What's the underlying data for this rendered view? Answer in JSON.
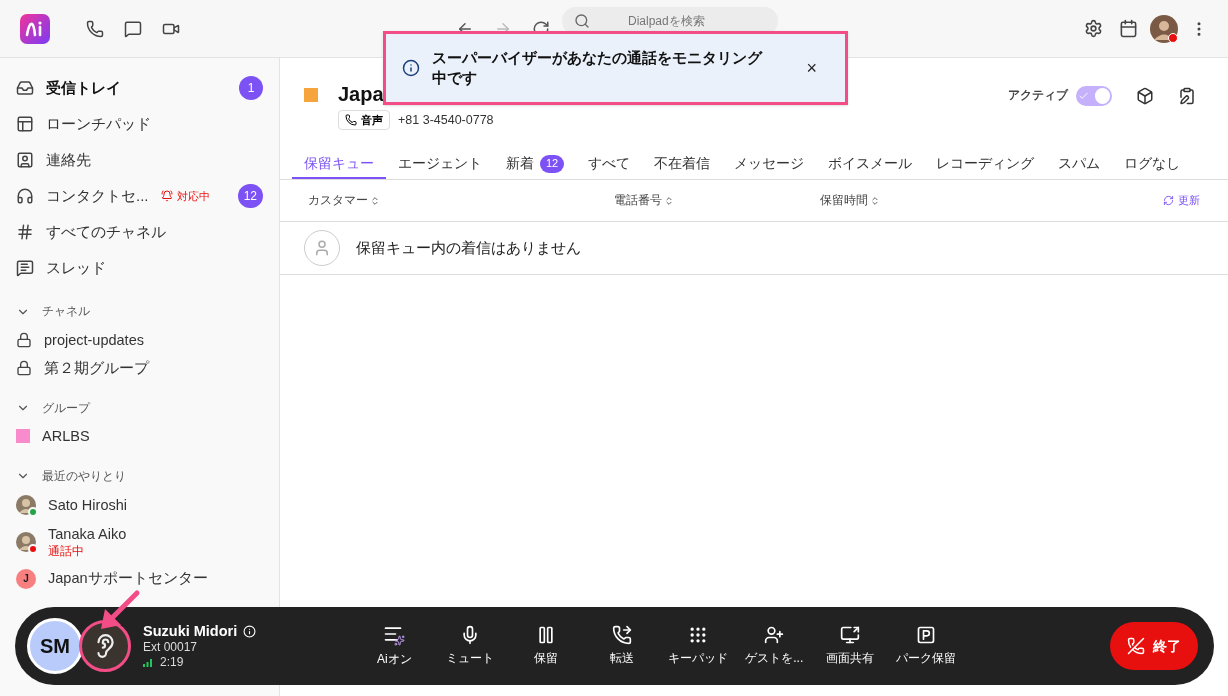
{
  "search": {
    "placeholder": "Dialpadを検索"
  },
  "toast": {
    "message": "スーパーバイザーがあなたの通話をモニタリング中です",
    "close": "×"
  },
  "sidebar": {
    "items": [
      {
        "kind": "inbox",
        "label": "受信トレイ",
        "badge": "1",
        "selected": true
      },
      {
        "kind": "launchpad",
        "label": "ローンチパッド",
        "selected": false
      },
      {
        "kind": "contacts",
        "label": "連絡先",
        "selected": false
      },
      {
        "kind": "contact-center",
        "label": "コンタクトセ...",
        "status": "対応中",
        "badge": "12",
        "selected": false
      },
      {
        "kind": "channels",
        "label": "すべてのチャネル",
        "selected": false
      },
      {
        "kind": "threads",
        "label": "スレッド",
        "selected": false
      }
    ],
    "sections": [
      {
        "title": "チャネル",
        "expanded": true,
        "items": [
          {
            "kind": "lock",
            "label": "project-updates"
          },
          {
            "kind": "lock",
            "label": "第２期グループ"
          }
        ]
      },
      {
        "title": "グループ",
        "expanded": true,
        "items": [
          {
            "kind": "square",
            "label": "ARLBS",
            "color": "#f78bcb"
          }
        ]
      },
      {
        "title": "最近のやりとり",
        "expanded": true,
        "items": [
          {
            "kind": "person",
            "label": "Sato Hiroshi",
            "color": "#22a447"
          },
          {
            "kind": "person",
            "label": "Tanaka Aiko",
            "status": "通話中",
            "color": "#e8100e"
          },
          {
            "kind": "initial",
            "label": "Japanサポートセンター",
            "initial": "J",
            "color": "#f77f7f"
          }
        ]
      }
    ]
  },
  "header": {
    "title": "Japa",
    "color": "#f5a53b",
    "channel": "音声",
    "phone": "+81 3-4540-0778",
    "active_label": "アクティブ",
    "active": true
  },
  "tabs": [
    {
      "label": "保留キュー",
      "selected": true
    },
    {
      "label": "エージェント",
      "selected": false
    },
    {
      "label": "新着",
      "badge": "12",
      "selected": false
    },
    {
      "label": "すべて",
      "selected": false
    },
    {
      "label": "不在着信",
      "selected": false
    },
    {
      "label": "メッセージ",
      "selected": false
    },
    {
      "label": "ボイスメール",
      "selected": false
    },
    {
      "label": "レコーディング",
      "selected": false
    },
    {
      "label": "スパム",
      "selected": false
    },
    {
      "label": "ログなし",
      "selected": false
    }
  ],
  "table": {
    "columns": [
      "カスタマー",
      "電話番号",
      "保留時間"
    ],
    "refresh": "更新",
    "empty": "保留キュー内の着信はありません"
  },
  "call": {
    "initials": "SM",
    "name": "Suzuki Midori",
    "ext": "Ext 00017",
    "duration": "2:19",
    "monitored": true,
    "actions": [
      {
        "kind": "ai",
        "label": "Aiオン"
      },
      {
        "kind": "mute",
        "label": "ミュート"
      },
      {
        "kind": "hold",
        "label": "保留"
      },
      {
        "kind": "transfer",
        "label": "転送"
      },
      {
        "kind": "keypad",
        "label": "キーパッド"
      },
      {
        "kind": "guest",
        "label": "ゲストを..."
      },
      {
        "kind": "share",
        "label": "画面共有"
      },
      {
        "kind": "park",
        "label": "パーク保留"
      }
    ],
    "end": "終了"
  }
}
